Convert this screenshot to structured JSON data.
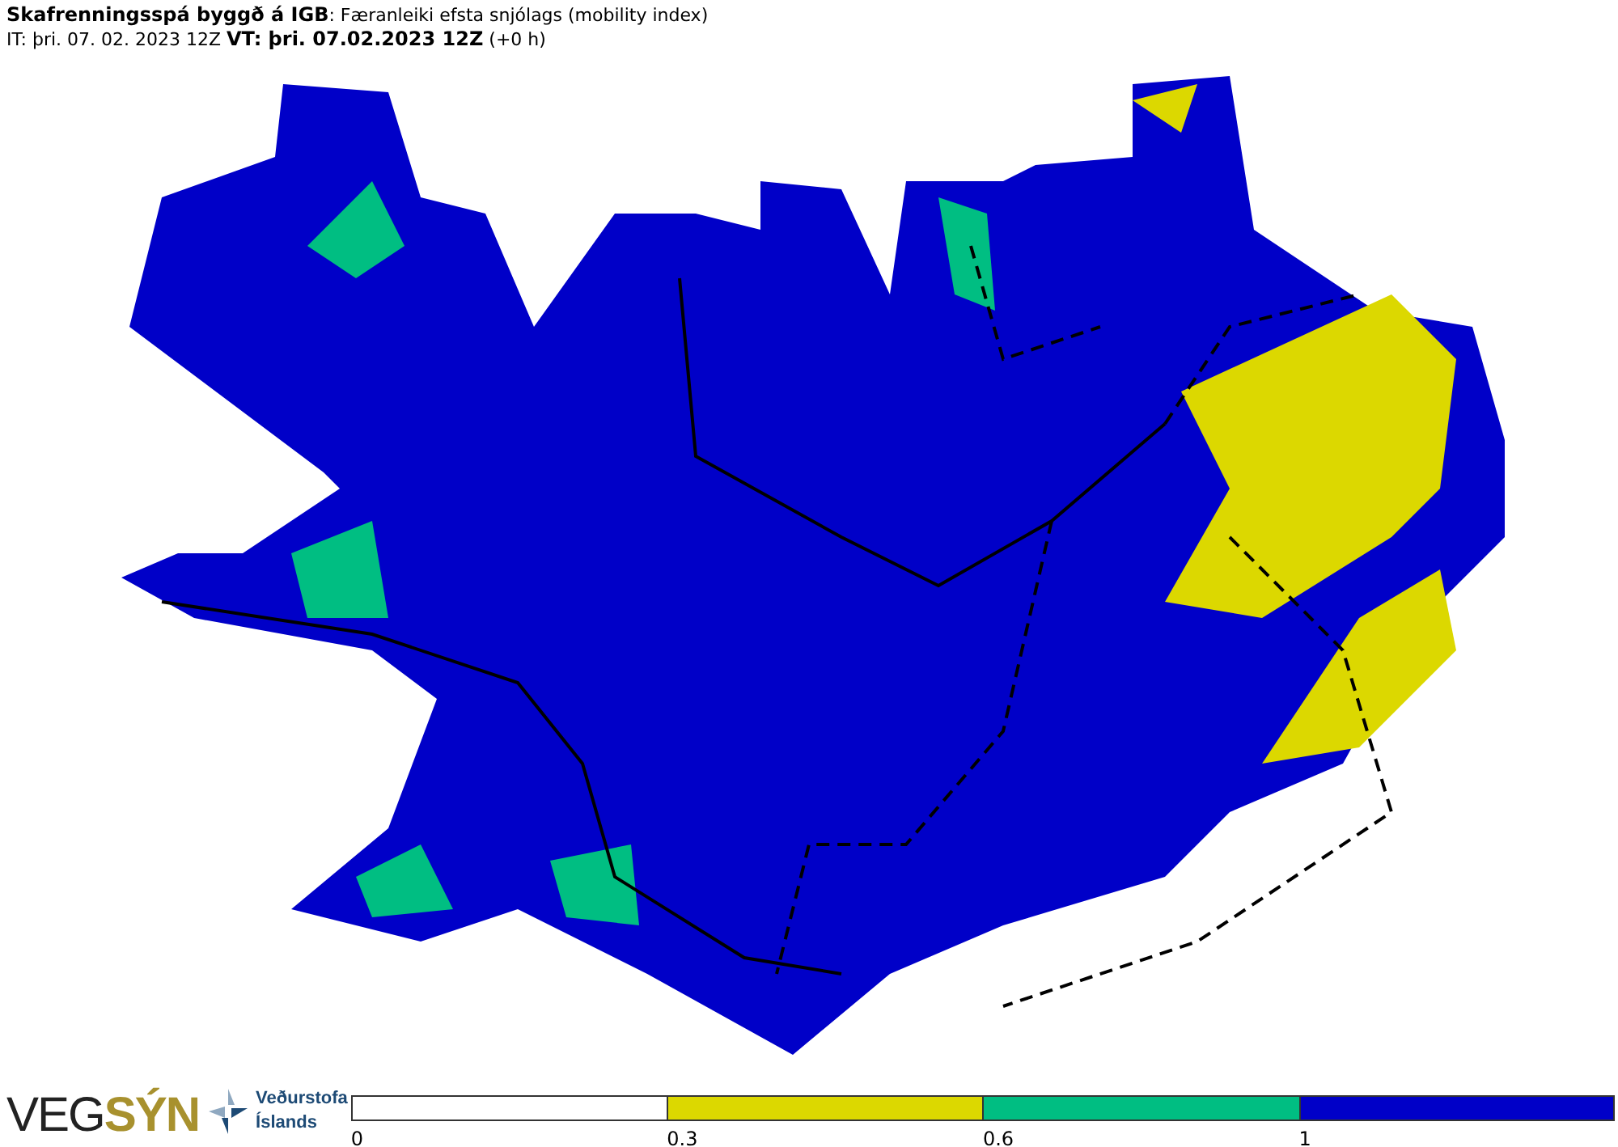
{
  "header": {
    "title": "**Skafrenningsspá byggð á IGB**: Færanleiki efsta snjólags (mobility index)",
    "times": "IT: þri. 07. 02. 2023 12Z **VT: þri. 07.02.2023 12Z** (+0 h)"
  },
  "logos": {
    "vegsyn": "VEG**SÝN**",
    "met_office": [
      "Veðurstofa",
      "Íslands"
    ]
  },
  "legend": [
    {
      "label": "0",
      "color": "#ffffff"
    },
    {
      "label": "0.3",
      "color": "#dcd800"
    },
    {
      "label": "0.6",
      "color": "#00be82"
    },
    {
      "label": "1",
      "color": "#0000c8"
    }
  ]
}
